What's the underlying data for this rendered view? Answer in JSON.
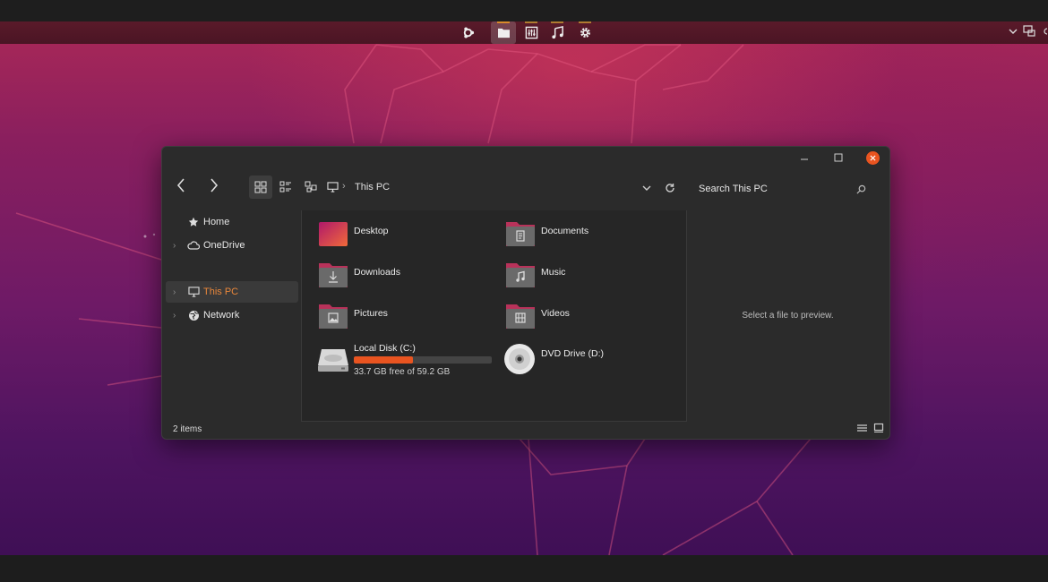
{
  "dock": {
    "items": [
      {
        "name": "ubuntu-logo-icon"
      },
      {
        "name": "folder-icon",
        "active": true
      },
      {
        "name": "mixer-icon"
      },
      {
        "name": "music-note-icon"
      },
      {
        "name": "gear-icon"
      }
    ]
  },
  "window": {
    "breadcrumb": "This PC",
    "search_placeholder": "Search This PC",
    "sidebar": {
      "items": [
        {
          "label": "Home",
          "icon": "star-icon",
          "expandable": false
        },
        {
          "label": "OneDrive",
          "icon": "cloud-icon",
          "expandable": true
        },
        {
          "label": "This PC",
          "icon": "monitor-icon",
          "expandable": true,
          "selected": true
        },
        {
          "label": "Network",
          "icon": "network-globe-icon",
          "expandable": true
        }
      ]
    },
    "folders": [
      {
        "label": "Desktop",
        "icon": "desktop-folder-icon"
      },
      {
        "label": "Documents",
        "icon": "documents-folder-icon"
      },
      {
        "label": "Downloads",
        "icon": "downloads-folder-icon"
      },
      {
        "label": "Music",
        "icon": "music-folder-icon"
      },
      {
        "label": "Pictures",
        "icon": "pictures-folder-icon"
      },
      {
        "label": "Videos",
        "icon": "videos-folder-icon"
      }
    ],
    "drives": [
      {
        "label": "Local Disk (C:)",
        "free_text": "33.7 GB free of 59.2 GB",
        "used_fraction": 0.43,
        "icon": "hard-drive-icon"
      },
      {
        "label": "DVD Drive (D:)",
        "icon": "dvd-drive-icon"
      }
    ],
    "preview_text": "Select a file to preview.",
    "status_count": "2 items"
  },
  "colors": {
    "accent": "#e95420",
    "selected_text": "#e9873a",
    "window_bg": "#2b2b2b"
  }
}
